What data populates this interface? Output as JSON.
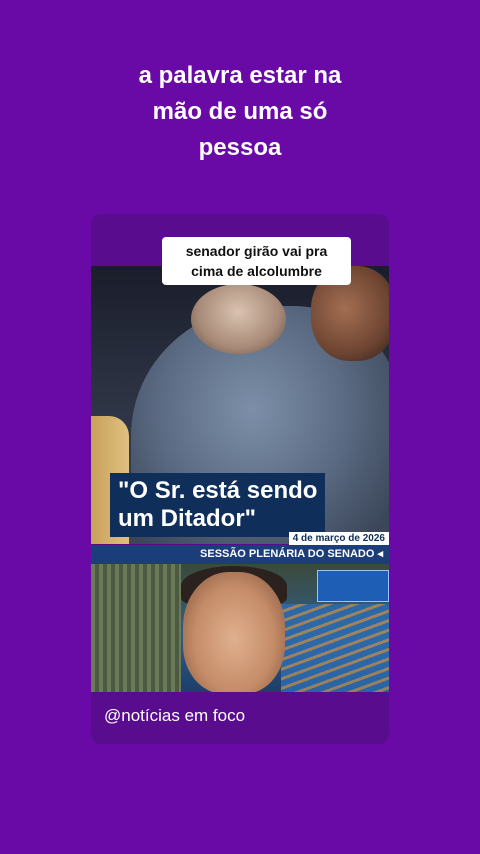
{
  "headline": {
    "lines": [
      "a palavra estar na",
      "mão de uma só",
      "pessoa"
    ]
  },
  "card": {
    "caption": "senador girão vai pra cima de alcolumbre",
    "quote": "\"O Sr. está sendo\num Ditador\"",
    "date": "4 de março de 2026",
    "session": "SESSÃO PLENÁRIA DO SENADO ◂",
    "handle": "@notícias em foco"
  },
  "colors": {
    "background": "#6a0aa6",
    "card": "#5a0c8e",
    "quote_box": "#0f2e5a",
    "session_bar": "#1b3e7a"
  }
}
